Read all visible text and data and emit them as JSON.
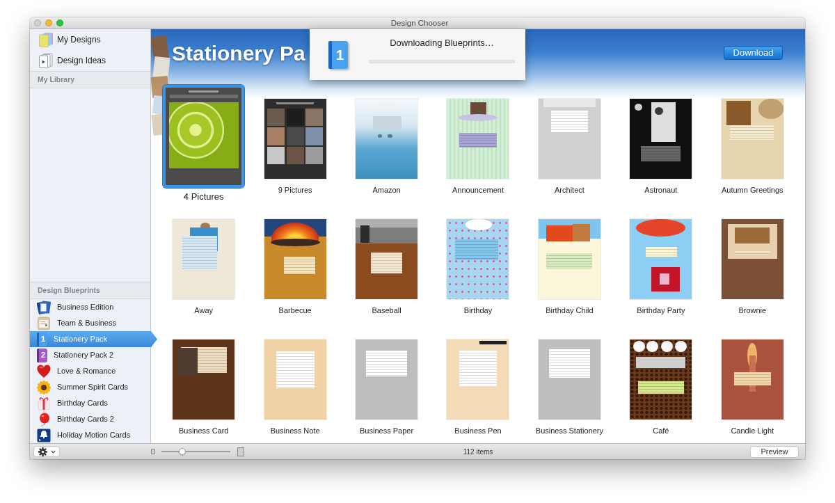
{
  "window": {
    "title": "Design Chooser"
  },
  "sidebar": {
    "top_items": [
      {
        "label": "My Designs",
        "selected": false
      },
      {
        "label": "Design Ideas",
        "selected": false
      }
    ],
    "library": {
      "title": "My Library"
    },
    "blueprints": {
      "title": "Design Blueprints",
      "items": [
        {
          "label": "Business Edition",
          "selected": false
        },
        {
          "label": "Team & Business",
          "selected": false
        },
        {
          "label": "Stationery Pack",
          "selected": true,
          "icon_label": "1"
        },
        {
          "label": "Stationery Pack 2",
          "selected": false,
          "icon_label": "2"
        },
        {
          "label": "Love & Romance",
          "selected": false
        },
        {
          "label": "Summer Spirit Cards",
          "selected": false
        },
        {
          "label": "Birthday Cards",
          "selected": false
        },
        {
          "label": "Birthday Cards 2",
          "selected": false
        },
        {
          "label": "Holiday Motion Cards",
          "selected": false
        }
      ]
    }
  },
  "banner": {
    "title": "Stationery Pa",
    "download_button": "Download"
  },
  "download_sheet": {
    "icon_label": "1",
    "message": "Downloading Blueprints…"
  },
  "designs": [
    {
      "name": "4 Pictures",
      "selected": true
    },
    {
      "name": "9 Pictures",
      "selected": false
    },
    {
      "name": "Amazon",
      "selected": false
    },
    {
      "name": "Announcement",
      "selected": false
    },
    {
      "name": "Architect",
      "selected": false
    },
    {
      "name": "Astronaut",
      "selected": false
    },
    {
      "name": "Autumn Greetings",
      "selected": false
    },
    {
      "name": "Away",
      "selected": false
    },
    {
      "name": "Barbecue",
      "selected": false
    },
    {
      "name": "Baseball",
      "selected": false
    },
    {
      "name": "Birthday",
      "selected": false
    },
    {
      "name": "Birthday Child",
      "selected": false
    },
    {
      "name": "Birthday Party",
      "selected": false
    },
    {
      "name": "Brownie",
      "selected": false
    },
    {
      "name": "Business Card",
      "selected": false
    },
    {
      "name": "Business Note",
      "selected": false
    },
    {
      "name": "Business Paper",
      "selected": false
    },
    {
      "name": "Business Pen",
      "selected": false
    },
    {
      "name": "Business Stationery",
      "selected": false
    },
    {
      "name": "Café",
      "selected": false
    },
    {
      "name": "Candle Light",
      "selected": false
    }
  ],
  "status_bar": {
    "zoom_slider": {
      "level": 0.3
    },
    "item_count": "112 items",
    "preview_button": "Preview"
  }
}
